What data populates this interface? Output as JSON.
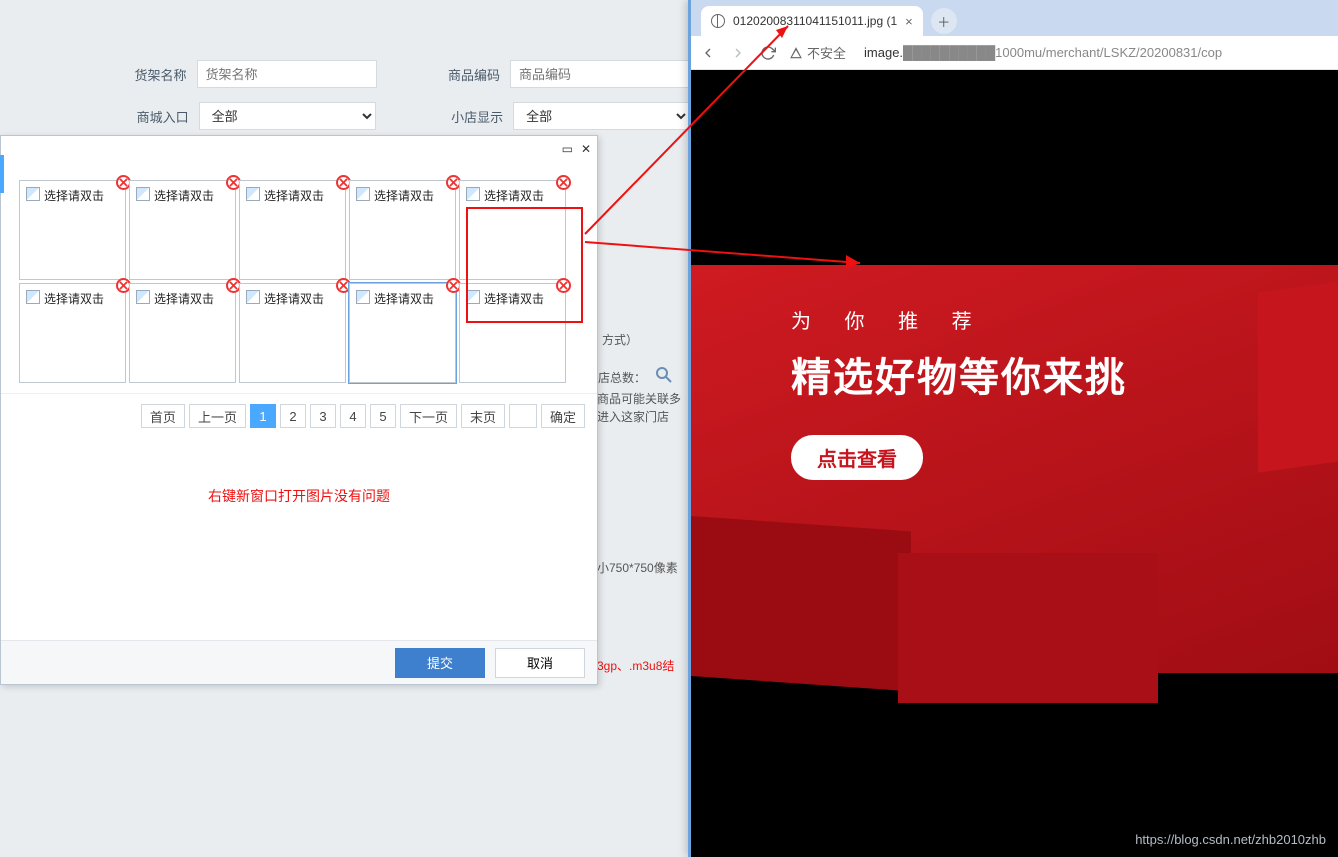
{
  "form": {
    "f1_label": "货架名称",
    "f1_ph": "货架名称",
    "f2_label": "商品编码",
    "f2_ph": "商品编码",
    "f3_label": "商城入口",
    "f3_val": "全部",
    "f4_label": "小店显示",
    "f4_val": "全部"
  },
  "dialog": {
    "thumb_label": "选择请双击",
    "pager": {
      "first": "首页",
      "prev": "上一页",
      "p1": "1",
      "p2": "2",
      "p3": "3",
      "p4": "4",
      "p5": "5",
      "next": "下一页",
      "last": "末页",
      "ok": "确定"
    },
    "note": "右键新窗口打开图片没有问题",
    "submit": "提交",
    "cancel": "取消"
  },
  "frags": {
    "a": "方式）",
    "b": "店总数：",
    "c": "商品可能关联多",
    "d": "进入这家门店",
    "e": "小750*750像素",
    "f": "3gp、.m3u8结"
  },
  "browser": {
    "tab_title": "01202008311041151011.jpg (1",
    "insecure": "不安全",
    "url_host": "image.",
    "url_mid": "1000mu/merchant/LSKZ/20200831/cop"
  },
  "banner": {
    "line1": "为 你 推 荐",
    "line2": "精选好物等你来挑",
    "btn": "点击查看"
  },
  "watermark": "https://blog.csdn.net/zhb2010zhb"
}
